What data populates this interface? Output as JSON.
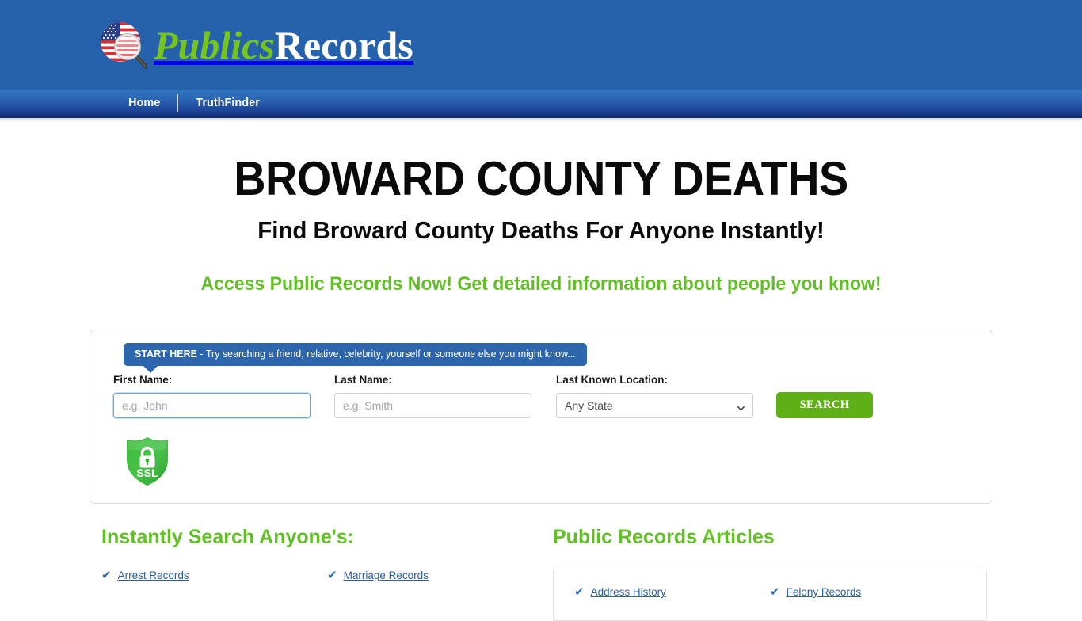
{
  "brand": {
    "logo_icon": "us-flag-magnifier-icon",
    "name_part_1": "Publics",
    "name_part_2": "Records",
    "header_bg": "#2661ab",
    "accent_green": "#76c41e"
  },
  "nav": {
    "items": [
      {
        "label": "Home"
      },
      {
        "label": "TruthFinder"
      }
    ]
  },
  "hero": {
    "title": "BROWARD COUNTY DEATHS",
    "subtitle": "Find Broward County Deaths For Anyone Instantly!",
    "tagline": "Access Public Records Now! Get detailed information about people you know!",
    "tagline_color": "#62bf26"
  },
  "search": {
    "tooltip_bold": "START HERE",
    "tooltip_rest": " - Try searching a friend, relative, celebrity, yourself or someone else you might know...",
    "first_name": {
      "label": "First Name:",
      "placeholder": "e.g. John",
      "value": ""
    },
    "last_name": {
      "label": "Last Name:",
      "placeholder": "e.g. Smith",
      "value": ""
    },
    "location": {
      "label": "Last Known Location:",
      "selected": "Any State",
      "options": [
        "Any State"
      ]
    },
    "button_label": "SEARCH",
    "button_color": "#5faf16",
    "ssl_badge_label": "SSL"
  },
  "instantly_search": {
    "heading": "Instantly Search Anyone's:",
    "links": [
      {
        "label": "Arrest Records"
      },
      {
        "label": "Marriage Records"
      }
    ]
  },
  "articles": {
    "heading": "Public Records Articles",
    "links": [
      {
        "label": "Address History"
      },
      {
        "label": "Felony Records"
      }
    ]
  }
}
